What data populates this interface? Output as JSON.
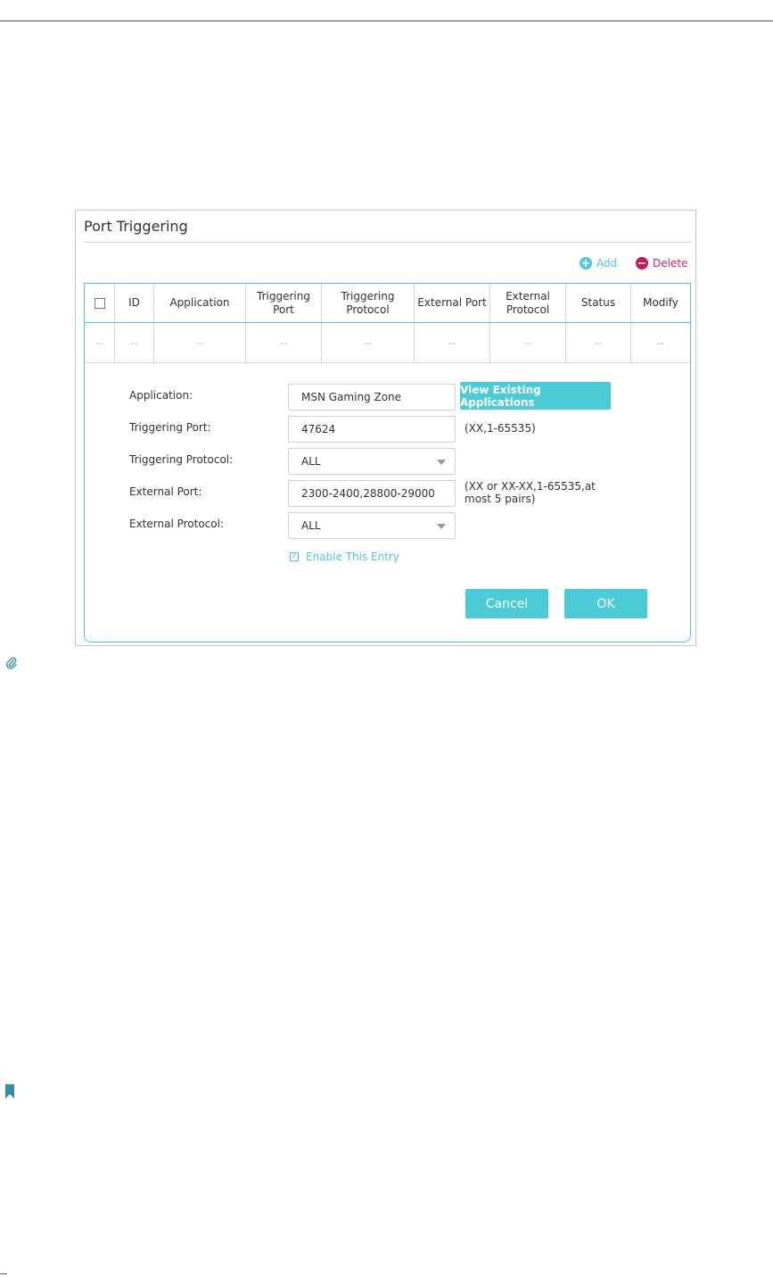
{
  "panel": {
    "title": "Port Triggering",
    "add_label": "Add",
    "delete_label": "Delete"
  },
  "table": {
    "columns": [
      "",
      "ID",
      "Application",
      "Triggering Port",
      "Triggering Protocol",
      "External Port",
      "External Protocol",
      "Status",
      "Modify"
    ],
    "row": [
      "--",
      "--",
      "--",
      "--",
      "--",
      "--",
      "--",
      "--",
      "--"
    ]
  },
  "form": {
    "application_label": "Application:",
    "application_value": "MSN Gaming Zone",
    "view_existing_label": "View Existing Applications",
    "triggering_port_label": "Triggering Port:",
    "triggering_port_value": "47624",
    "triggering_port_hint": "(XX,1-65535)",
    "triggering_protocol_label": "Triggering Protocol:",
    "triggering_protocol_value": "ALL",
    "external_port_label": "External Port:",
    "external_port_value": "2300-2400,28800-29000",
    "external_port_hint": "(XX or XX-XX,1-65535,at most 5 pairs)",
    "external_protocol_label": "External Protocol:",
    "external_protocol_value": "ALL",
    "enable_label": "Enable This Entry",
    "enable_checked": true,
    "cancel_label": "Cancel",
    "ok_label": "OK"
  },
  "colors": {
    "accent": "#4acbd6",
    "delete": "#c8185a"
  },
  "icons": {
    "add": "plus-circle-icon",
    "delete": "minus-circle-icon",
    "note": "paperclip-icon",
    "tip": "bookmark-icon"
  }
}
